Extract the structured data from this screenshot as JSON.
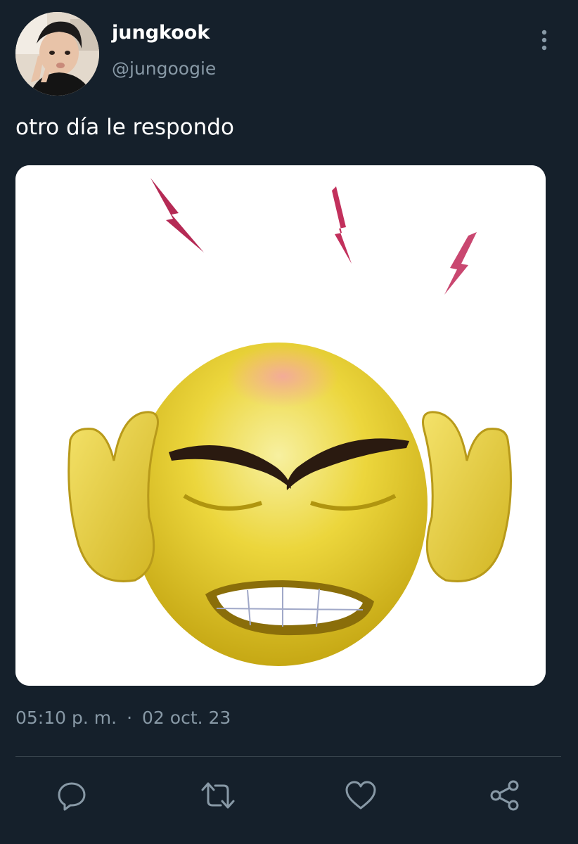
{
  "author": {
    "display_name": "jungkook",
    "handle": "@jungoogie"
  },
  "tweet": {
    "text": "otro día le respondo",
    "time": "05:10 p. m.",
    "separator": "·",
    "date": "02 oct. 23"
  },
  "media": {
    "description_icon": "angry-emoji-image"
  },
  "actions": {
    "reply_icon": "reply-icon",
    "retweet_icon": "retweet-icon",
    "like_icon": "heart-icon",
    "share_icon": "share-icon"
  },
  "colors": {
    "background": "#15202b",
    "secondary_text": "#8899a6",
    "divider": "#38444d"
  }
}
